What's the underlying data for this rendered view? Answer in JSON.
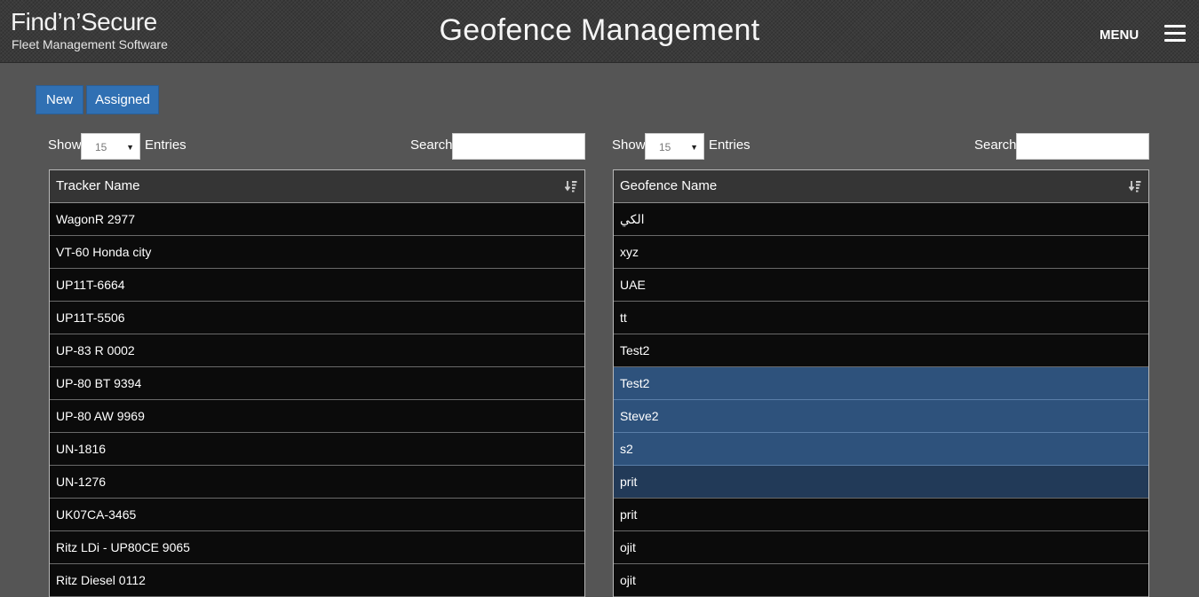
{
  "header": {
    "logo_title": "Find’n’Secure",
    "logo_subtitle": "Fleet Management Software",
    "page_title": "Geofence Management",
    "menu_label": "MENU",
    "menu_icon": "hamburger-icon"
  },
  "toolbar": {
    "new_label": "New",
    "assigned_label": "Assigned",
    "button_color": "#3070b3"
  },
  "left_panel": {
    "show_label": "Show",
    "page_size": "15",
    "entries_label": "Entries",
    "search_label": "Search",
    "search_value": "",
    "column_header": "Tracker Name",
    "rows": [
      "WagonR 2977",
      "VT-60 Honda city",
      "UP11T-6664",
      "UP11T-5506",
      "UP-83 R 0002",
      "UP-80 BT 9394",
      "UP-80 AW 9969",
      "UN-1816",
      "UN-1276",
      "UK07CA-3465",
      "Ritz LDi - UP80CE 9065",
      "Ritz Diesel 0112"
    ]
  },
  "right_panel": {
    "show_label": "Show",
    "page_size": "15",
    "entries_label": "Entries",
    "search_label": "Search",
    "search_value": "",
    "column_header": "Geofence Name",
    "rows": [
      "الكي",
      "xyz",
      "UAE",
      "tt",
      "Test2",
      "Test2",
      "Steve2",
      "s2",
      "prit",
      "prit",
      "ojit",
      "ojit"
    ],
    "selected_row_color": "#2e527c"
  }
}
